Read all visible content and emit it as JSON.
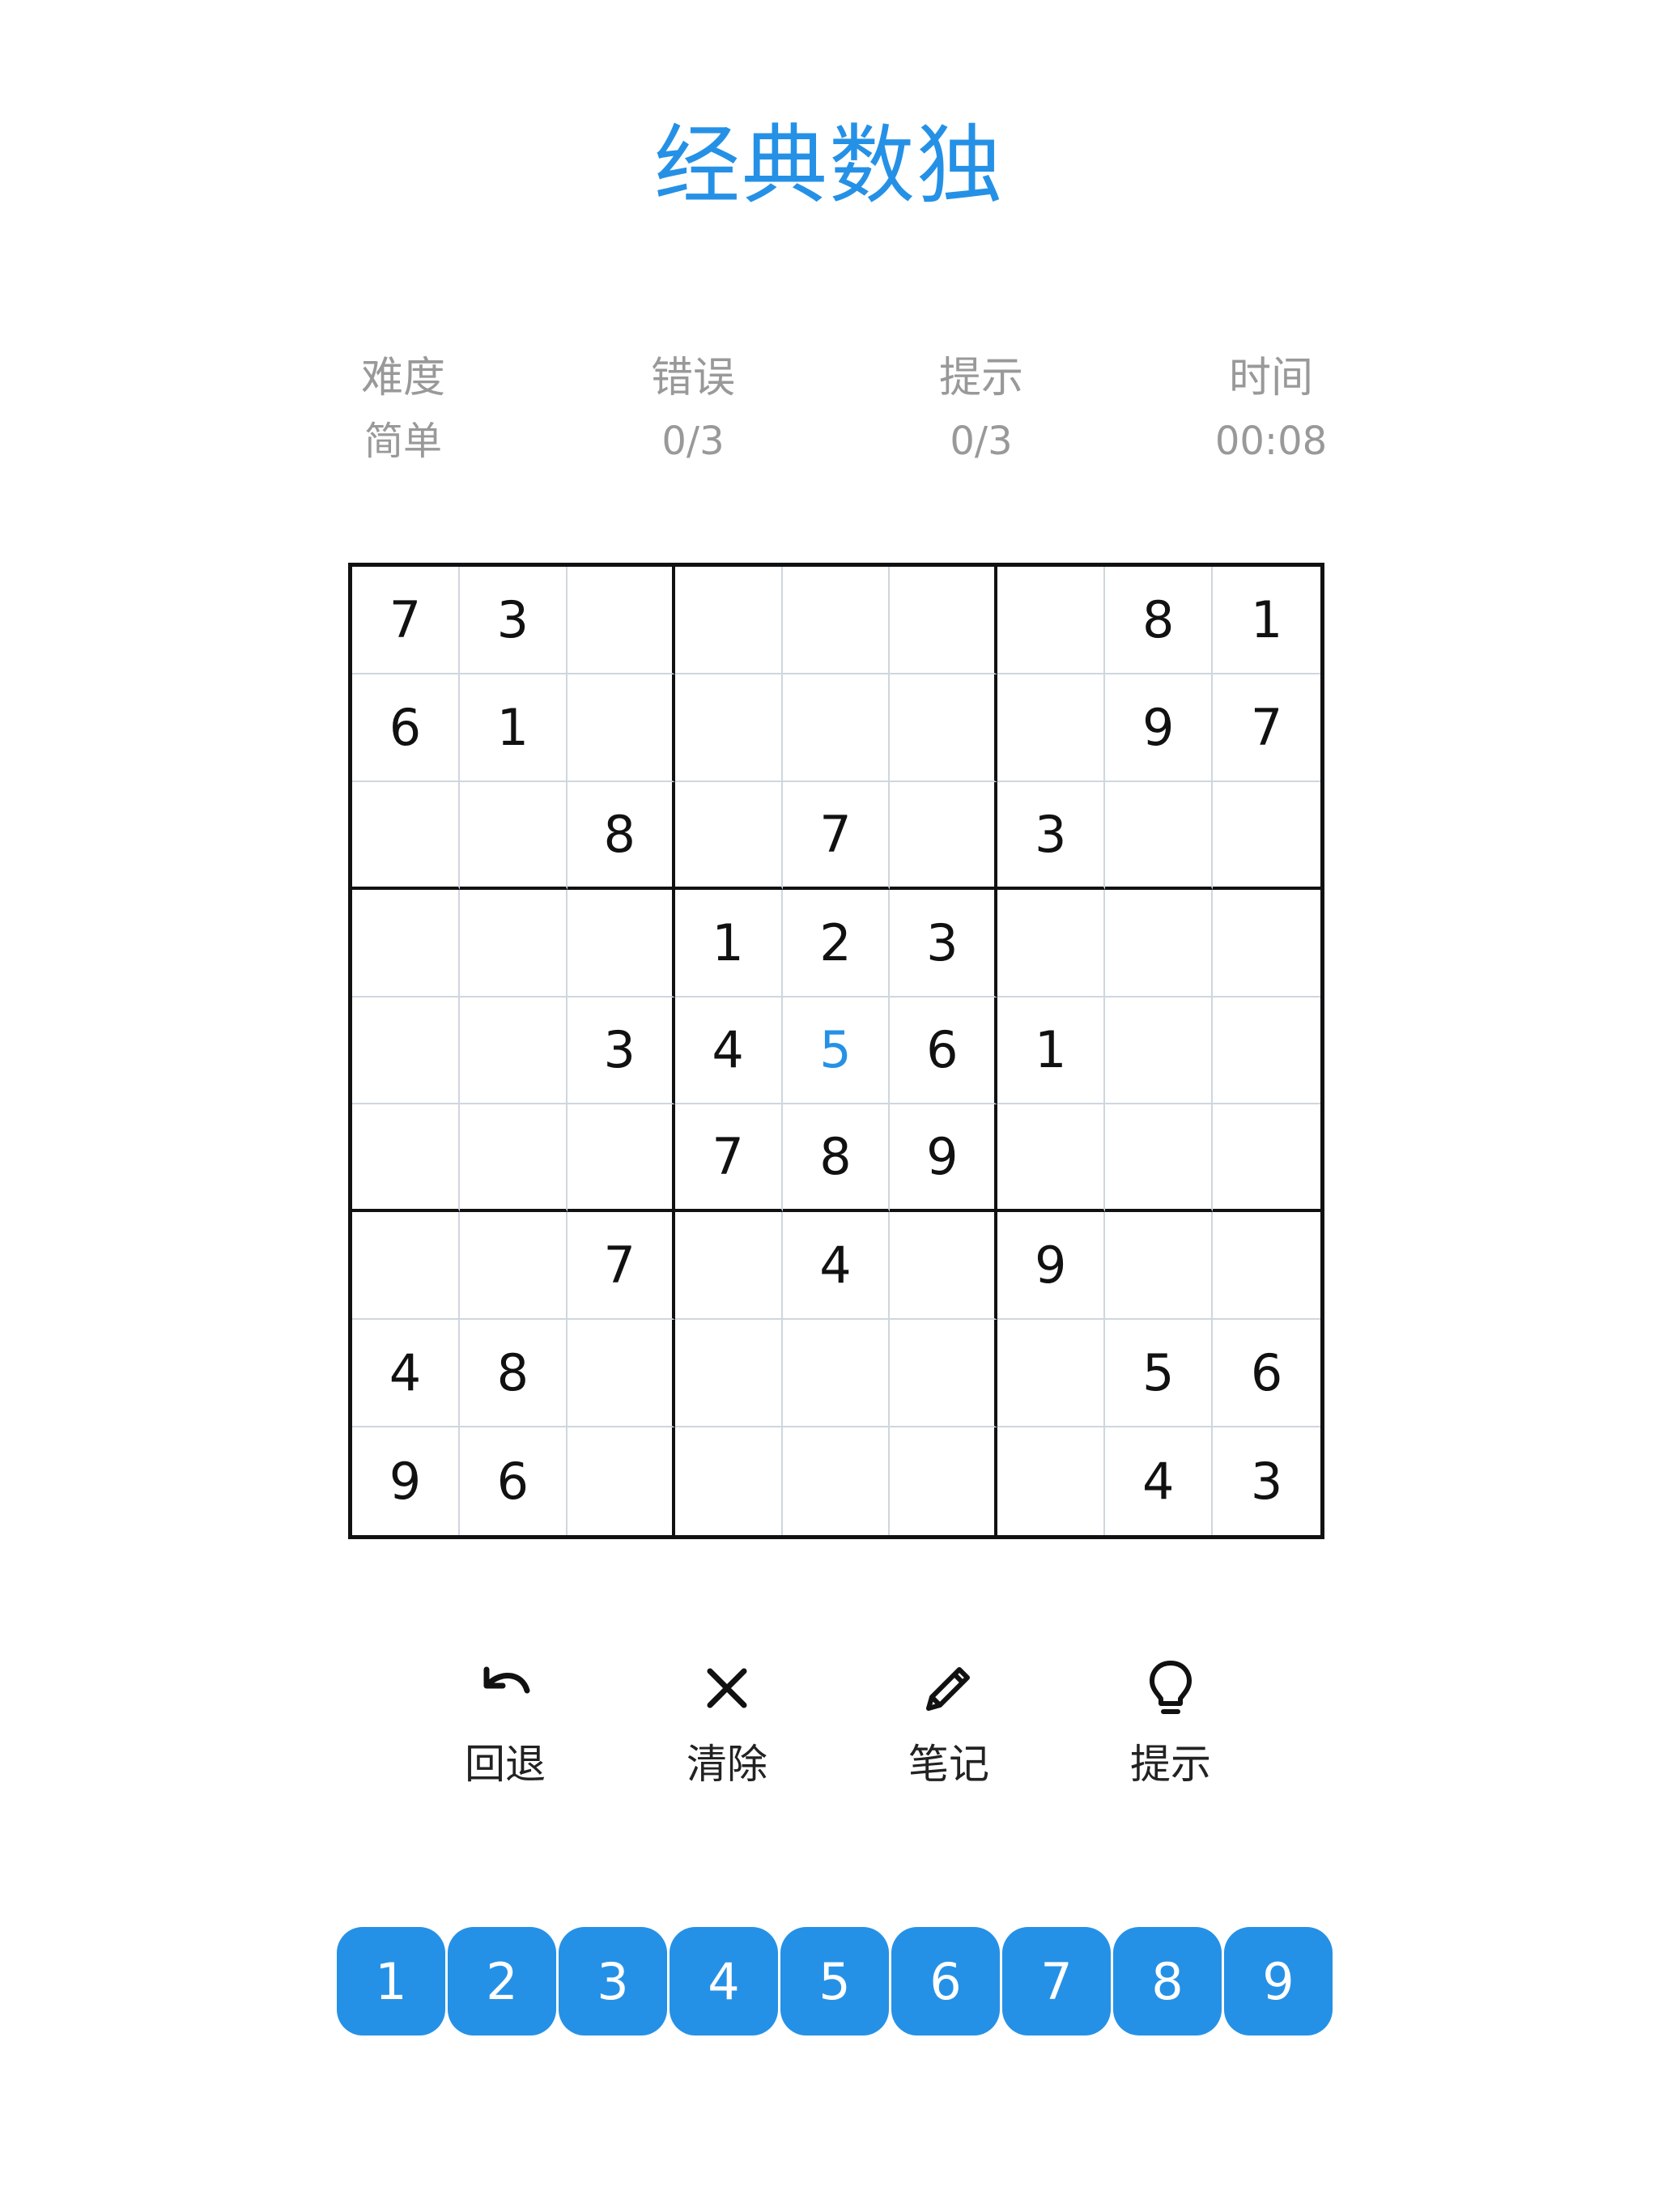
{
  "app": {
    "title": "经典数独"
  },
  "colors": {
    "accent": "#2591e6",
    "stat_text": "#999999",
    "grid_line": "#cfd6de",
    "box_line": "#111111"
  },
  "stats": {
    "difficulty": {
      "label": "难度",
      "value": "简单"
    },
    "mistakes": {
      "label": "错误",
      "value": "0/3"
    },
    "hints": {
      "label": "提示",
      "value": "0/3"
    },
    "time": {
      "label": "时间",
      "value": "00:08"
    }
  },
  "board": {
    "rows": [
      [
        "7",
        "3",
        "",
        "",
        "",
        "",
        "",
        "8",
        "1"
      ],
      [
        "6",
        "1",
        "",
        "",
        "",
        "",
        "",
        "9",
        "7"
      ],
      [
        "",
        "",
        "8",
        "",
        "7",
        "",
        "3",
        "",
        ""
      ],
      [
        "",
        "",
        "",
        "1",
        "2",
        "3",
        "",
        "",
        ""
      ],
      [
        "",
        "",
        "3",
        "4",
        "5",
        "6",
        "1",
        "",
        ""
      ],
      [
        "",
        "",
        "",
        "7",
        "8",
        "9",
        "",
        "",
        ""
      ],
      [
        "",
        "",
        "7",
        "",
        "4",
        "",
        "9",
        "",
        ""
      ],
      [
        "4",
        "8",
        "",
        "",
        "",
        "",
        "",
        "5",
        "6"
      ],
      [
        "9",
        "6",
        "",
        "",
        "",
        "",
        "",
        "4",
        "3"
      ]
    ],
    "user_entries": [
      {
        "row": 4,
        "col": 4
      }
    ]
  },
  "tools": {
    "undo": {
      "label": "回退",
      "icon": "undo-icon"
    },
    "erase": {
      "label": "清除",
      "icon": "close-icon"
    },
    "notes": {
      "label": "笔记",
      "icon": "pencil-icon"
    },
    "hint": {
      "label": "提示",
      "icon": "lightbulb-icon"
    }
  },
  "numpad": [
    "1",
    "2",
    "3",
    "4",
    "5",
    "6",
    "7",
    "8",
    "9"
  ]
}
